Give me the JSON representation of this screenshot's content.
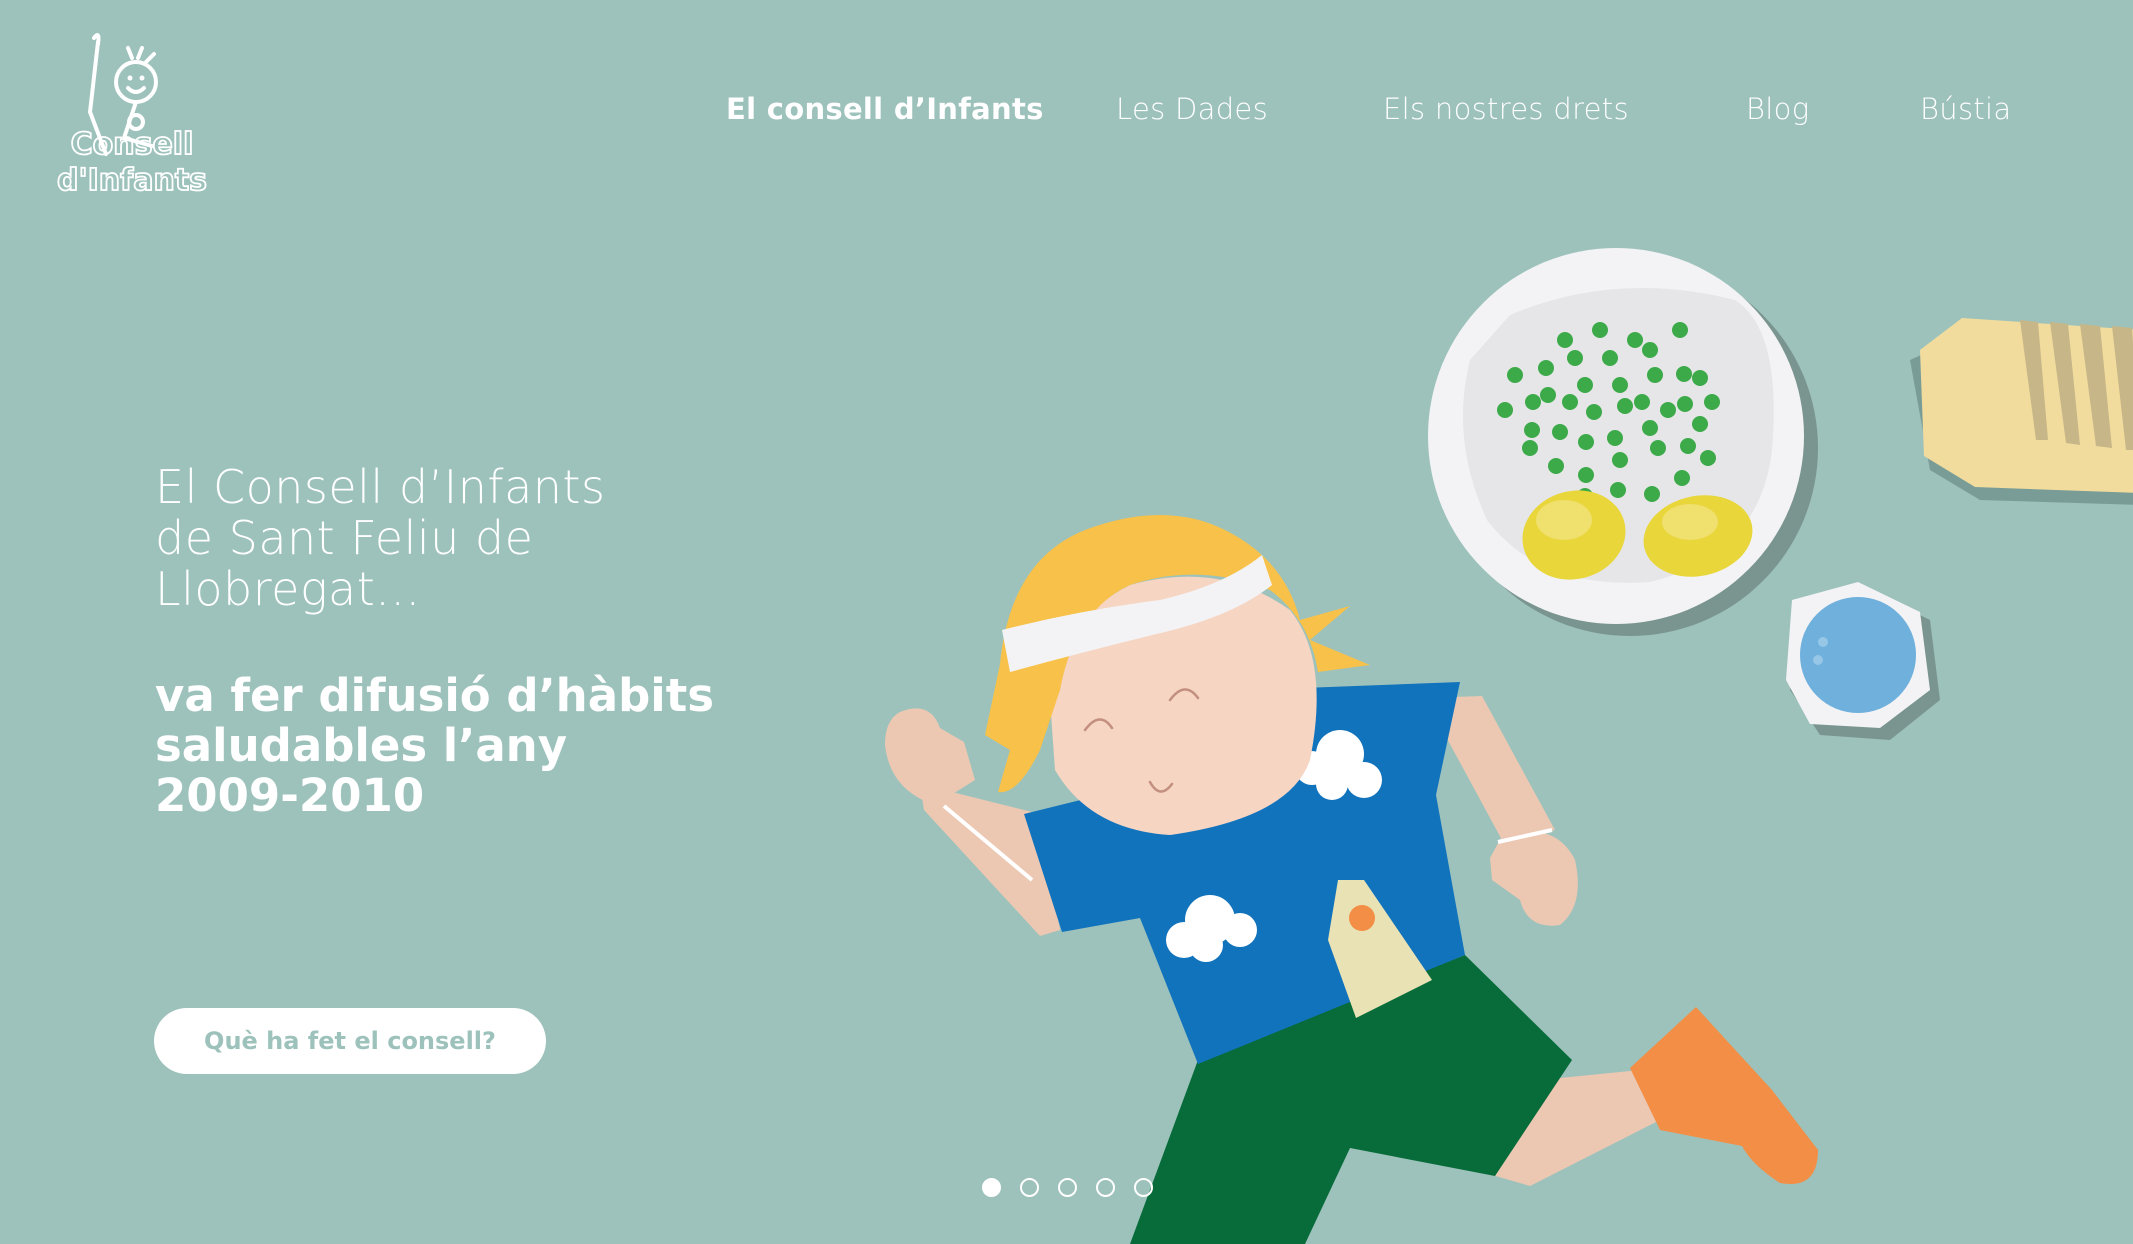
{
  "logo": {
    "line1": "Consell",
    "line2": "d'Infants"
  },
  "nav": [
    {
      "label": "El consell d’Infants",
      "active": true
    },
    {
      "label": "Les Dades",
      "active": false
    },
    {
      "label": "Els nostres drets",
      "active": false
    },
    {
      "label": "Blog",
      "active": false
    },
    {
      "label": "Bústia",
      "active": false
    }
  ],
  "hero": {
    "intro_lines": [
      "El Consell d’Infants",
      "de Sant Feliu de",
      "Llobregat..."
    ],
    "headline_lines": [
      "va fer difusió d’hàbits",
      "saludables l’any",
      "2009-2010"
    ],
    "cta_label": "Què ha fet el consell?"
  },
  "slider": {
    "count": 5,
    "active_index": 0
  },
  "colors": {
    "background": "#9dc2bb",
    "text": "#ffffff",
    "shirt": "#1273bd",
    "shorts": "#076b3a",
    "hair": "#f8c14a",
    "skin": "#ecc8b3",
    "shoe": "#f28e45",
    "peas": "#3daa4a",
    "water": "#6fb0dc"
  },
  "icons": [
    "logo-child-icon",
    "cloud-icon",
    "plate-icon",
    "glass-icon",
    "bread-icon"
  ]
}
